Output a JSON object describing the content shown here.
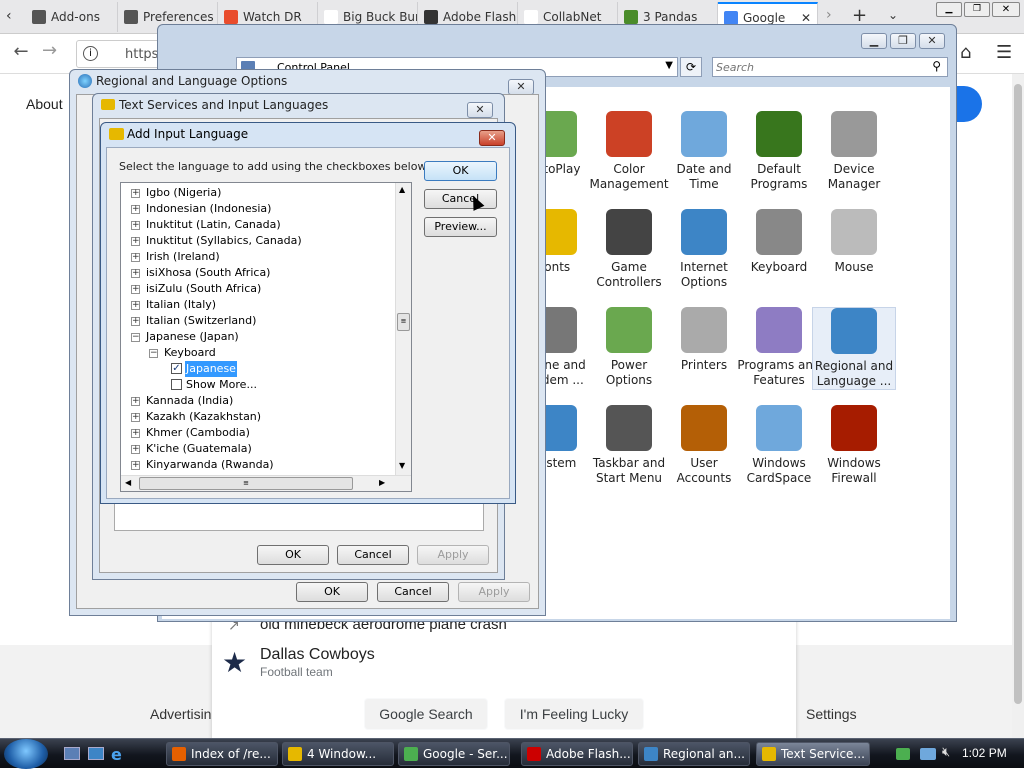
{
  "firefox": {
    "tabs": [
      {
        "label": "Add-ons",
        "color": "#555"
      },
      {
        "label": "Preferences",
        "color": "#555"
      },
      {
        "label": "Watch DR",
        "color": "#e94c2c"
      },
      {
        "label": "Big Buck Bunny",
        "color": "#fff"
      },
      {
        "label": "Adobe Flash",
        "color": "#333"
      },
      {
        "label": "CollabNet",
        "color": "#fff"
      },
      {
        "label": "3 Pandas",
        "color": "#4a8c2a"
      },
      {
        "label": "Google",
        "color": "#4285f4"
      }
    ],
    "url": "https"
  },
  "google": {
    "about": "About",
    "search_button": "Google Search",
    "lucky_button": "I'm Feeling Lucky",
    "advertising": "Advertising",
    "settings": "Settings",
    "suggestion1": "old minebeck aerodrome plane crash",
    "suggestion2_title": "Dallas Cowboys",
    "suggestion2_sub": "Football team"
  },
  "control_panel": {
    "breadcrumb": "Control Panel",
    "search_placeholder": "Search",
    "items": [
      {
        "label": "AutoPlay",
        "color": "#6aa84f"
      },
      {
        "label": "Color Management",
        "color": "#cc4125"
      },
      {
        "label": "Date and Time",
        "color": "#6fa8dc"
      },
      {
        "label": "Default Programs",
        "color": "#38761d"
      },
      {
        "label": "Device Manager",
        "color": "#999999"
      },
      {
        "label": "Fonts",
        "color": "#e6b800"
      },
      {
        "label": "Game Controllers",
        "color": "#444444"
      },
      {
        "label": "Internet Options",
        "color": "#3d85c6"
      },
      {
        "label": "Keyboard",
        "color": "#888888"
      },
      {
        "label": "Mouse",
        "color": "#bbbbbb"
      },
      {
        "label": "Phone and Modem ...",
        "color": "#777777"
      },
      {
        "label": "Power Options",
        "color": "#6aa84f"
      },
      {
        "label": "Printers",
        "color": "#aaaaaa"
      },
      {
        "label": "Programs and Features",
        "color": "#8e7cc3"
      },
      {
        "label": "Regional and Language ...",
        "color": "#3d85c6"
      },
      {
        "label": "System",
        "color": "#3d85c6"
      },
      {
        "label": "Taskbar and Start Menu",
        "color": "#555555"
      },
      {
        "label": "User Accounts",
        "color": "#b45f06"
      },
      {
        "label": "Windows CardSpace",
        "color": "#6fa8dc"
      },
      {
        "label": "Windows Firewall",
        "color": "#a61c00"
      }
    ]
  },
  "regional": {
    "title": "Regional and Language Options",
    "ok": "OK",
    "cancel": "Cancel",
    "apply": "Apply"
  },
  "text_services": {
    "title": "Text Services and Input Languages",
    "ok": "OK",
    "cancel": "Cancel",
    "apply": "Apply"
  },
  "add_input": {
    "title": "Add Input Language",
    "instruction": "Select the language to add using the checkboxes below.",
    "ok": "OK",
    "cancel": "Cancel",
    "preview": "Preview...",
    "tree": [
      {
        "label": "Igbo (Nigeria)",
        "level": 0,
        "expander": "+"
      },
      {
        "label": "Indonesian (Indonesia)",
        "level": 0,
        "expander": "+"
      },
      {
        "label": "Inuktitut (Latin, Canada)",
        "level": 0,
        "expander": "+"
      },
      {
        "label": "Inuktitut (Syllabics, Canada)",
        "level": 0,
        "expander": "+"
      },
      {
        "label": "Irish (Ireland)",
        "level": 0,
        "expander": "+"
      },
      {
        "label": "isiXhosa (South Africa)",
        "level": 0,
        "expander": "+"
      },
      {
        "label": "isiZulu (South Africa)",
        "level": 0,
        "expander": "+"
      },
      {
        "label": "Italian (Italy)",
        "level": 0,
        "expander": "+"
      },
      {
        "label": "Italian (Switzerland)",
        "level": 0,
        "expander": "+"
      },
      {
        "label": "Japanese (Japan)",
        "level": 0,
        "expander": "-"
      },
      {
        "label": "Keyboard",
        "level": 1,
        "expander": "-"
      },
      {
        "label": "Japanese",
        "level": 2,
        "checkbox": true,
        "checked": true,
        "selected": true
      },
      {
        "label": "Show More...",
        "level": 2,
        "checkbox": true,
        "checked": false
      },
      {
        "label": "Kannada (India)",
        "level": 0,
        "expander": "+"
      },
      {
        "label": "Kazakh (Kazakhstan)",
        "level": 0,
        "expander": "+"
      },
      {
        "label": "Khmer (Cambodia)",
        "level": 0,
        "expander": "+"
      },
      {
        "label": "K'iche (Guatemala)",
        "level": 0,
        "expander": "+"
      },
      {
        "label": "Kinyarwanda (Rwanda)",
        "level": 0,
        "expander": "+"
      }
    ]
  },
  "taskbar": {
    "clock": "1:02 PM",
    "items": [
      {
        "label": "Index of /re...",
        "color": "#e66000"
      },
      {
        "label": "4 Window...",
        "color": "#e6b800"
      },
      {
        "label": "Google - Ser...",
        "color": "#4caf50"
      },
      {
        "label": "Adobe Flash...",
        "color": "#cc0000"
      },
      {
        "label": "Regional an...",
        "color": "#3d85c6"
      },
      {
        "label": "Text Service...",
        "color": "#e6b800"
      }
    ]
  }
}
